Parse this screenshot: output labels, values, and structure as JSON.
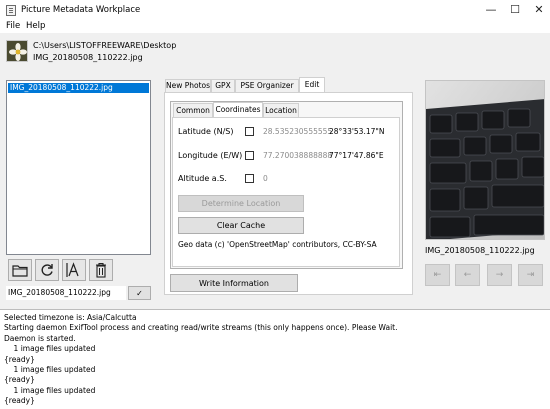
{
  "window": {
    "title": "Picture Metadata Workplace",
    "minimize_glyph": "—",
    "maximize_glyph": "☐",
    "close_glyph": "✕"
  },
  "menu": [
    {
      "label": "File"
    },
    {
      "label": "Help"
    }
  ],
  "file_header": {
    "path": "C:\\Users\\LISTOFFREEWARE\\Desktop",
    "filename": "IMG_20180508_110222.jpg",
    "icon": "flower-thumbnail-icon"
  },
  "file_list": {
    "items": [
      "IMG_20180508_110222.jpg"
    ],
    "selected_index": 0
  },
  "toolbar": {
    "buttons": [
      "open-folder-icon",
      "refresh-icon",
      "rename-icon",
      "delete-icon"
    ]
  },
  "filename_field": {
    "value": "IMG_20180508_110222.jpg",
    "confirm_glyph": "✓"
  },
  "main_tabs": [
    {
      "label": "New Photos",
      "active": false
    },
    {
      "label": "GPX",
      "active": false
    },
    {
      "label": "PSE Organizer",
      "active": false
    },
    {
      "label": "Edit",
      "active": true
    }
  ],
  "sub_tabs": [
    {
      "label": "Common",
      "active": false
    },
    {
      "label": "Coordinates",
      "active": true
    },
    {
      "label": "Location",
      "active": false
    }
  ],
  "coordinates": {
    "latitude": {
      "label": "Latitude (N/S)",
      "decimal": "28.535230555555",
      "dms": "28°33'53.17\"N",
      "checked": false
    },
    "longitude": {
      "label": "Longitude (E/W)",
      "decimal": "77.270038888888",
      "dms": "77°17'47.86\"E",
      "checked": false
    },
    "altitude": {
      "label": "Altitude a.S.",
      "value": "0",
      "checked": false
    }
  },
  "buttons": {
    "determine_location": "Determine Location",
    "clear_cache": "Clear Cache",
    "write_information": "Write Information"
  },
  "geo_note": "Geo data (c) 'OpenStreetMap' contributors, CC-BY-SA",
  "preview": {
    "caption": "IMG_20180508_110222.jpg",
    "nav": [
      "⇤",
      "←",
      "→",
      "⇥"
    ]
  },
  "colors": {
    "selection": "#0078d7",
    "disabled_text": "#9a9a9a",
    "background": "#f0f0f0"
  },
  "log": [
    "Selected timezone is: Asia/Calcutta",
    "Starting daemon ExifTool process and creating read/write streams (this only happens once). Please Wait.",
    "Daemon is started.",
    "    1 image files updated",
    "{ready}",
    "    1 image files updated",
    "{ready}",
    "    1 image files updated",
    "{ready}"
  ]
}
